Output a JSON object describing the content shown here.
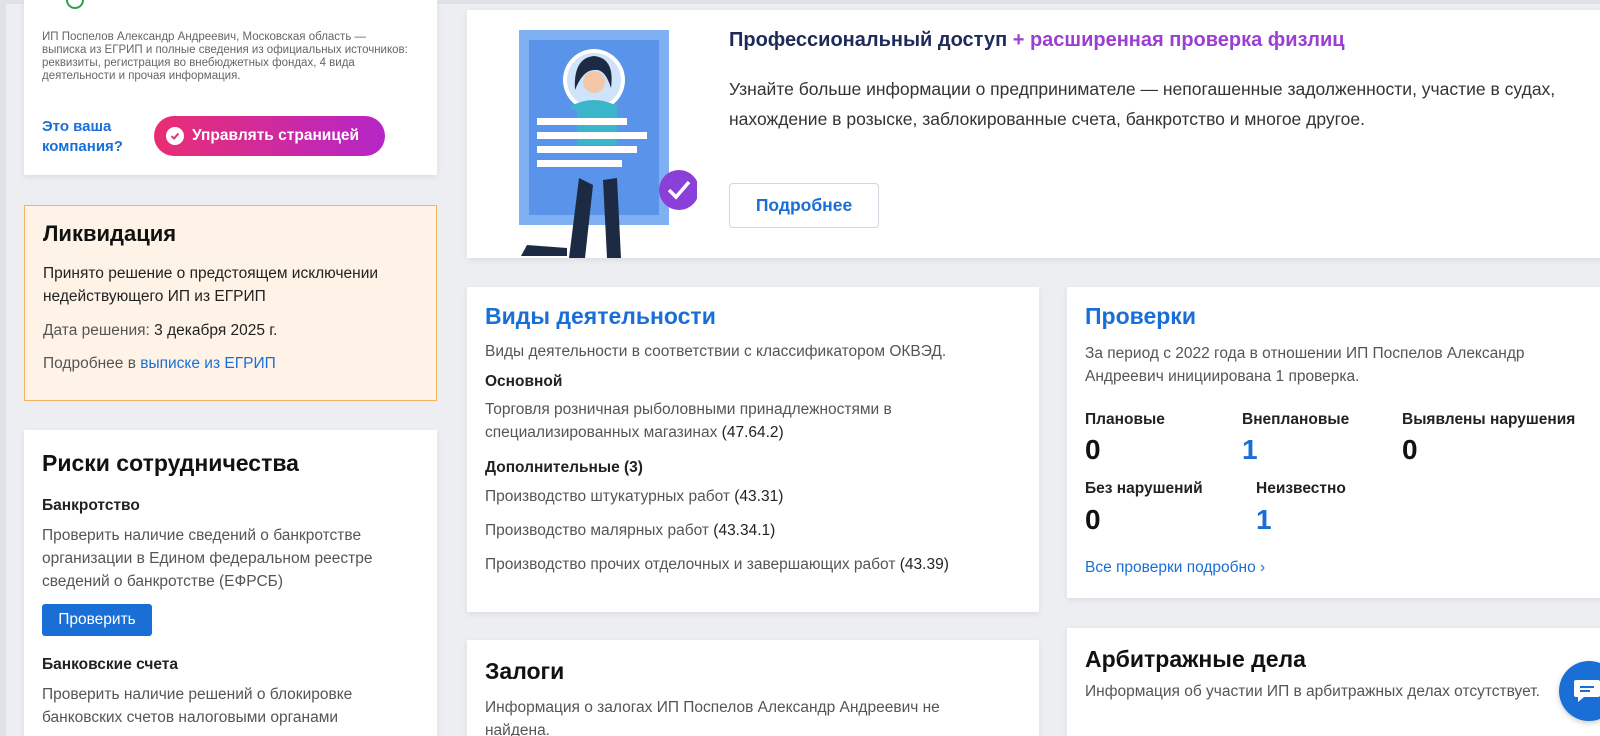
{
  "owner_card": {
    "description": "ИП Поспелов Александр Андреевич, Московская область — выписка из ЕГРИП и полные сведения из официальных источников: реквизиты, регистрация во внебюджетных фондах, 4 вида деятельности и прочая информация.",
    "is_yours": "Это ваша компания?",
    "manage_label": "Управлять страницей"
  },
  "liquidation": {
    "title": "Ликвидация",
    "text": "Принято решение о предстоящем исключении недействующего ИП из ЕГРИП",
    "date_label": "Дата решения:",
    "date_value": "3 декабря 2025 г.",
    "more_prefix": "Подробнее в",
    "more_link": "выписке из ЕГРИП"
  },
  "risks": {
    "title": "Риски сотрудничества",
    "bankruptcy_title": "Банкротство",
    "bankruptcy_text": "Проверить наличие сведений о банкротстве организации в Едином федеральном реестре сведений о банкротстве (ЕФРСБ)",
    "check_label": "Проверить",
    "accounts_title": "Банковские счета",
    "accounts_text": "Проверить наличие решений о блокировке банковских счетов налоговыми органами"
  },
  "promo": {
    "title_main": "Профессиональный доступ",
    "title_plus": "+ расширенная проверка физлиц",
    "body": "Узнайте больше информации о предпринимателе — непогашенные задолженности, участие в судах, нахождение в розыске, заблокированные счета, банкротство и многое другое.",
    "more_label": "Подробнее"
  },
  "activities": {
    "title": "Виды деятельности",
    "subtitle": "Виды деятельности в соответствии с классификатором ОКВЭД.",
    "main_label": "Основной",
    "main_item": {
      "name": "Торговля розничная рыболовными принадлежностями в специализированных магазинах",
      "code": "(47.64.2)"
    },
    "extra_label": "Дополнительные (3)",
    "extra_items": [
      {
        "name": "Производство штукатурных работ",
        "code": "(43.31)"
      },
      {
        "name": "Производство малярных работ",
        "code": "(43.34.1)"
      },
      {
        "name": "Производство прочих отделочных и завершающих работ",
        "code": "(43.39)"
      }
    ]
  },
  "inspections": {
    "title": "Проверки",
    "subtitle": "За период с 2022 года в отношении ИП Поспелов Александр Андреевич инициирована 1 проверка.",
    "planned_label": "Плановые",
    "planned_value": "0",
    "unplanned_label": "Внеплановые",
    "unplanned_value": "1",
    "violations_label": "Выявлены нарушения",
    "violations_value": "0",
    "no_violations_label": "Без нарушений",
    "no_violations_value": "0",
    "unknown_label": "Неизвестно",
    "unknown_value": "1",
    "all_link": "Все проверки подробно ›"
  },
  "pledges": {
    "title": "Залоги",
    "text": "Информация о залогах ИП Поспелов Александр Андреевич не найдена."
  },
  "arbitration": {
    "title": "Арбитражные дела",
    "text": "Информация об участии ИП в арбитражных делах отсутствует."
  },
  "colors": {
    "accent": "#1a6fd6",
    "gradient_start": "#ea2d72",
    "gradient_end": "#b526c8",
    "liquidation_bg": "#fef3e6"
  }
}
